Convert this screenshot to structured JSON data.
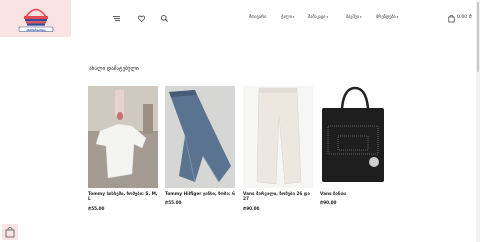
{
  "header": {
    "logo_text": "ანამარიამდე",
    "nav": [
      {
        "label": "მთავარი",
        "dropdown": false
      },
      {
        "label": "ქალი",
        "dropdown": true
      },
      {
        "label": "მამაკაცი",
        "dropdown": true
      },
      {
        "label": "ბავშვი",
        "dropdown": true
      },
      {
        "label": "ბრენდები",
        "dropdown": true
      }
    ],
    "cart_total": "0.00 ₾",
    "icons": [
      "menu-icon",
      "heart-icon",
      "search-icon",
      "cart-icon"
    ]
  },
  "section_title": "ახალი დამატებული",
  "products": [
    {
      "name": "Tommy სისხეში, ზომები: S, M, L",
      "meta": "",
      "price_label": "",
      "price": "₾55.00"
    },
    {
      "name": "Tommy Hilfiger ჯინსი, ზომა: 6",
      "meta": "",
      "price_label": "",
      "price": "₾55.00"
    },
    {
      "name": "Vans შარვალი, ზომები 26 და 27",
      "meta": "",
      "price_label": "",
      "price": "₾90.00"
    },
    {
      "name": "Vans ჩანთა",
      "meta": "",
      "price_label": "",
      "price": "₾90.00"
    }
  ],
  "colors": {
    "accent": "#fbe3e3",
    "brand_red": "#e8484f",
    "brand_blue": "#2c4fa3"
  }
}
